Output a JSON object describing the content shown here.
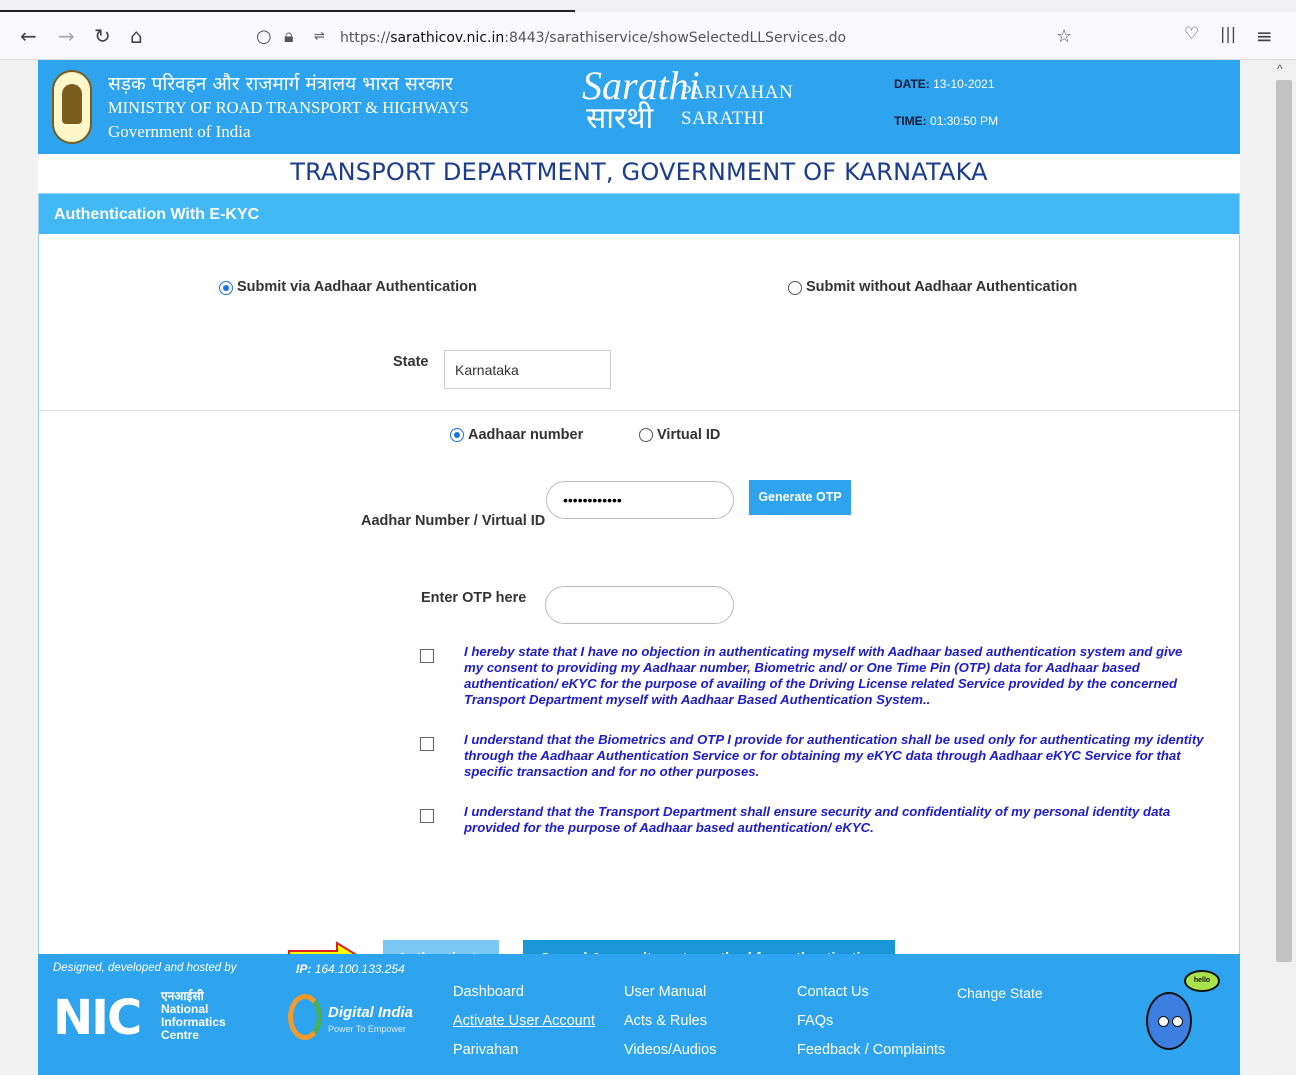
{
  "browser": {
    "url_prefix": "https://",
    "url_host": "sarathicov.nic.in",
    "url_rest": ":8443/sarathiservice/showSelectedLLServices.do"
  },
  "header": {
    "ministry_hindi": "सड़क परिवहन और राजमार्ग मंत्रालय भारत सरकार",
    "ministry_english": "MINISTRY OF ROAD TRANSPORT & HIGHWAYS",
    "government": "Government of India",
    "logo_top": "Sarathi",
    "logo_bottom": "सारथी",
    "brand_line1": "PARIVAHAN",
    "brand_line2": "SARATHI",
    "date_label": "DATE:",
    "date_value": "13-10-2021",
    "time_label": "TIME:",
    "time_value": "01:30:50 PM"
  },
  "department_title": "TRANSPORT DEPARTMENT, GOVERNMENT OF KARNATAKA",
  "panel": {
    "title": "Authentication With E-KYC",
    "option_via": "Submit via Aadhaar Authentication",
    "option_without": "Submit without Aadhaar Authentication",
    "state_label": "State",
    "state_value": "Karnataka",
    "id_option_aadhaar": "Aadhaar number",
    "id_option_virtual": "Virtual ID",
    "aadhar_label": "Aadhar Number / Virtual ID",
    "aadhar_value": "••••••••••••",
    "generate_otp": "Generate OTP",
    "otp_label": "Enter OTP here",
    "otp_value": "",
    "declarations": [
      "I hereby state that I have no objection in authenticating myself with Aadhaar based authentication system and give my consent to providing my Aadhaar number, Biometric and/ or One Time Pin (OTP) data for Aadhaar based authentication/ eKYC for the purpose of availing of the Driving License related Service provided by the concerned Transport Department myself with Aadhaar Based Authentication System..",
      "I understand that the Biometrics and OTP I provide for authentication shall be used only for authenticating my identity through the Aadhaar Authentication Service or for obtaining my eKYC data through Aadhaar eKYC Service for that specific transaction and for no other purposes.",
      "I understand that the Transport Department shall ensure security and confidentiality of my personal identity data provided for the purpose of Aadhaar based authentication/ eKYC."
    ],
    "authenticate": "Authenticate",
    "cancel": "Cancel & use alternate method for authentication"
  },
  "footer": {
    "designed": "Designed, developed and hosted by",
    "ip_label": "IP:",
    "ip_value": "164.100.133.254",
    "nic_hindi": "एनआईसी",
    "nic_line1": "National",
    "nic_line2": "Informatics",
    "nic_line3": "Centre",
    "digital_india": "Digital India",
    "digital_india_sub": "Power To Empower",
    "links": {
      "dashboard": "Dashboard",
      "activate": "Activate User Account",
      "parivahan": "Parivahan",
      "manual": "User Manual",
      "acts": "Acts & Rules",
      "videos": "Videos/Audios",
      "contact": "Contact Us",
      "faqs": "FAQs",
      "feedback": "Feedback / Complaints",
      "change_state": "Change State"
    },
    "mascot_text": "hello"
  },
  "colors": {
    "header_blue": "#2ea3ee",
    "panel_head": "#42b9f5",
    "title_navy": "#1c3c8c",
    "declaration_blue": "#1c1cd0",
    "arrow_yellow": "#ffff00",
    "arrow_red": "#e02020"
  }
}
